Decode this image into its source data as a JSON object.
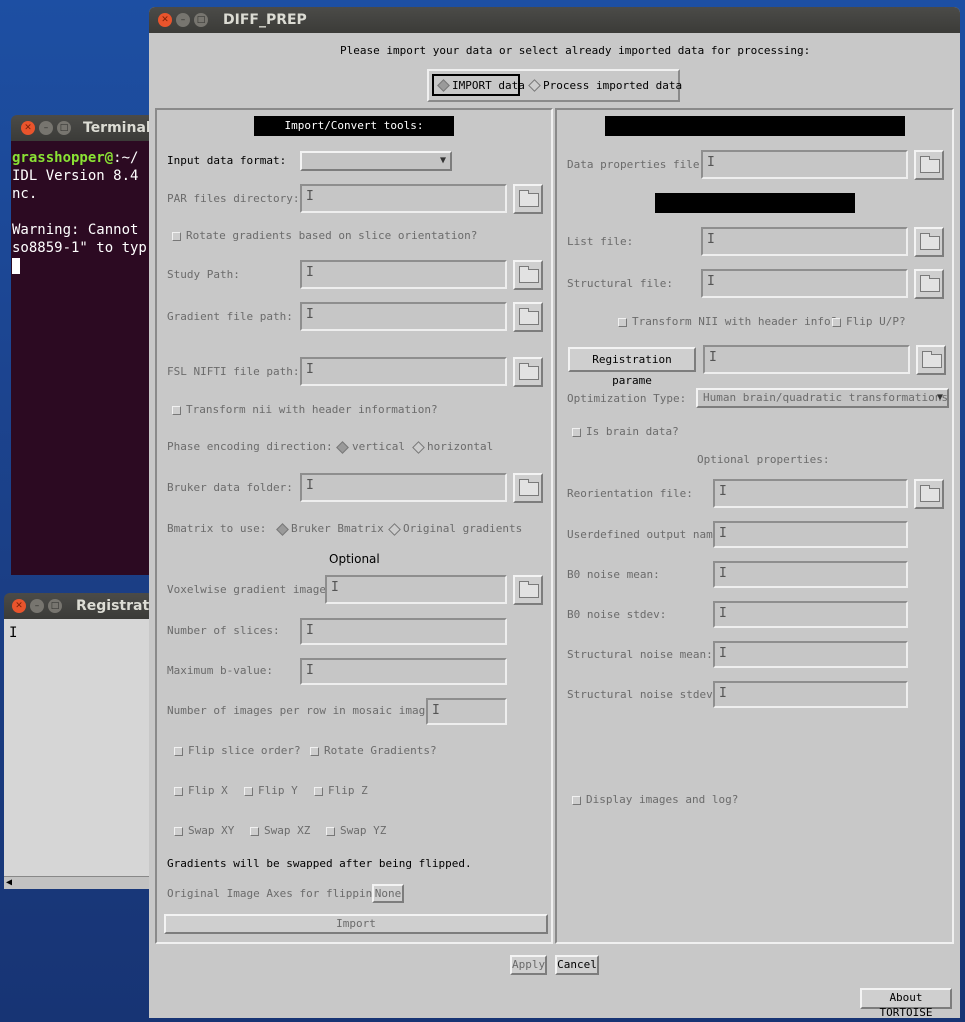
{
  "terminal": {
    "title": "Terminal",
    "line1_user": "grasshopper@",
    "line1_rest": ":~/",
    "line2": "IDL Version 8.4",
    "line3": "nc.",
    "line5": "Warning: Cannot",
    "line6": "so8859-1\" to typ"
  },
  "registration": {
    "title": "Registratio",
    "cursor": "I"
  },
  "main": {
    "title": "DIFF_PREP",
    "prompt": "Please import your data or select already imported data for processing:",
    "mode_import": "IMPORT data",
    "mode_process": "Process imported data",
    "left": {
      "header": "Import/Convert tools:",
      "input_format_label": "Input data format:",
      "par_dir_label": "PAR files directory:",
      "rotate_label": "Rotate gradients based on slice orientation?",
      "study_path_label": "Study Path:",
      "gradient_file_label": "Gradient file path:",
      "fsl_label": "FSL NIFTI file path:",
      "transform_nii_label": "Transform nii with header information?",
      "phase_label": "Phase encoding direction:",
      "phase_vertical": "vertical",
      "phase_horizontal": "horizontal",
      "bruker_label": "Bruker data folder:",
      "bmatrix_label": "Bmatrix to use:",
      "bmatrix_bruker": "Bruker Bmatrix",
      "bmatrix_original": "Original gradients",
      "optional_label": "Optional",
      "voxelwise_label": "Voxelwise gradient image:",
      "num_slices_label": "Number of slices:",
      "max_bvalue_label": "Maximum b-value:",
      "mosaic_label": "Number of images per row in mosaic images:",
      "flip_slice_label": "Flip slice order?",
      "rotate_grad_label": "Rotate Gradients?",
      "flip_x": "Flip X",
      "flip_y": "Flip Y",
      "flip_z": "Flip Z",
      "swap_xy": "Swap XY",
      "swap_xz": "Swap XZ",
      "swap_yz": "Swap YZ",
      "swap_note": "Gradients will be swapped after being flipped.",
      "orig_axes_label": "Original Image Axes for flipping:",
      "orig_axes_value": "None",
      "import_button": "Import"
    },
    "right": {
      "data_props_label": "Data properties file:",
      "list_file_label": "List file:",
      "structural_label": "Structural file:",
      "transform_nii_label": "Transform NII with header info?",
      "flip_up_label": "Flip U/P?",
      "reg_params_button": "Registration parame",
      "opt_type_label": "Optimization Type:",
      "opt_type_value": "Human brain/quadratic transformations",
      "brain_label": "Is brain data?",
      "optional_props_label": "Optional properties:",
      "reorient_label": "Reorientation file:",
      "userdef_label": "Userdefined output name",
      "b0_mean_label": "B0 noise mean:",
      "b0_std_label": "B0 noise stdev:",
      "struct_mean_label": "Structural noise mean:",
      "struct_std_label": "Structural noise stdev:",
      "display_label": "Display images and log?"
    },
    "apply_button": "Apply",
    "cancel_button": "Cancel",
    "about_button": "About TORTOISE"
  }
}
